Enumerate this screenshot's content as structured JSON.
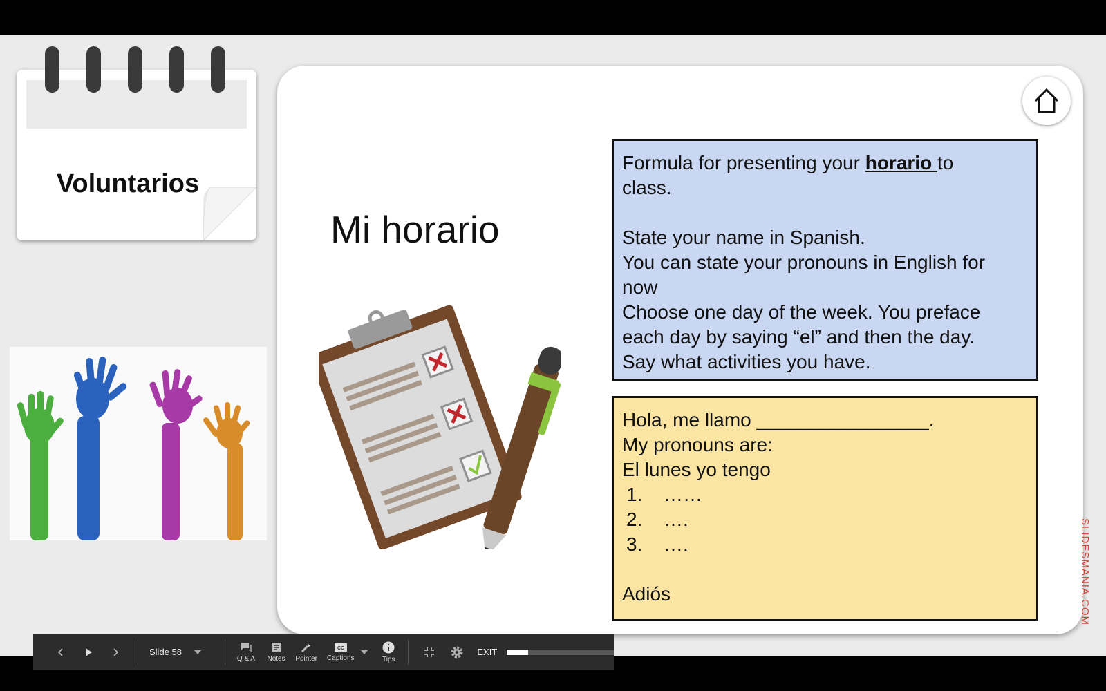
{
  "notepad": {
    "title": "Voluntarios"
  },
  "slide": {
    "title": "Mi horario",
    "formula_box": {
      "line1_before": "Formula for presenting your ",
      "line1_bold": "horario ",
      "line1_after": "to",
      "line2": "class.",
      "lines": [
        "State your name in Spanish.",
        "You can state your pronouns in English for",
        "now",
        "Choose one day of the week. You preface",
        "each day by saying “el” and then the day.",
        "Say what activities you have."
      ]
    },
    "template_box": {
      "lines": [
        "Hola, me llamo ________________.",
        "My pronouns are:",
        "El lunes yo tengo"
      ],
      "list": [
        {
          "num": "1.",
          "text": "……"
        },
        {
          "num": "2.",
          "text": "…."
        },
        {
          "num": "3.",
          "text": "…."
        }
      ],
      "closing": "Adiós"
    },
    "watermark": "SLIDESMANIA.COM",
    "watermark_color": "#d2473a",
    "formula_box_color": "#c9d7f3",
    "template_box_color": "#fce5a3"
  },
  "toolbar": {
    "slide_label": "Slide 58",
    "qa_label": "Q & A",
    "notes_label": "Notes",
    "pointer_label": "Pointer",
    "captions_label": "Captions",
    "tips_label": "Tips",
    "exit_label": "EXIT",
    "progress": 0.2
  }
}
